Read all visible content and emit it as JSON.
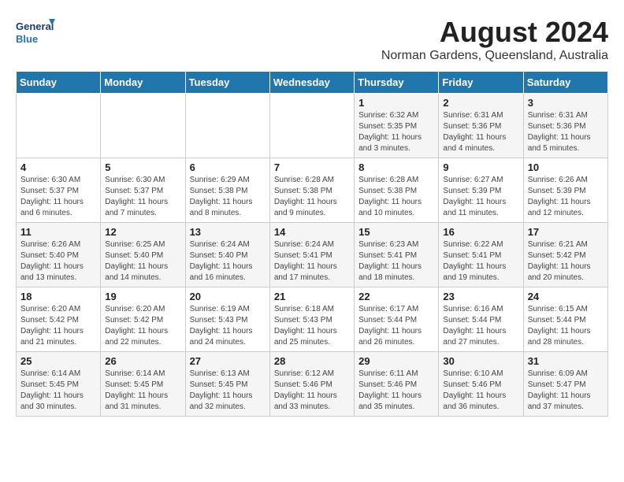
{
  "header": {
    "logo_line1": "General",
    "logo_line2": "Blue",
    "month_year": "August 2024",
    "location": "Norman Gardens, Queensland, Australia"
  },
  "weekdays": [
    "Sunday",
    "Monday",
    "Tuesday",
    "Wednesday",
    "Thursday",
    "Friday",
    "Saturday"
  ],
  "weeks": [
    [
      {
        "day": "",
        "info": ""
      },
      {
        "day": "",
        "info": ""
      },
      {
        "day": "",
        "info": ""
      },
      {
        "day": "",
        "info": ""
      },
      {
        "day": "1",
        "info": "Sunrise: 6:32 AM\nSunset: 5:35 PM\nDaylight: 11 hours\nand 3 minutes."
      },
      {
        "day": "2",
        "info": "Sunrise: 6:31 AM\nSunset: 5:36 PM\nDaylight: 11 hours\nand 4 minutes."
      },
      {
        "day": "3",
        "info": "Sunrise: 6:31 AM\nSunset: 5:36 PM\nDaylight: 11 hours\nand 5 minutes."
      }
    ],
    [
      {
        "day": "4",
        "info": "Sunrise: 6:30 AM\nSunset: 5:37 PM\nDaylight: 11 hours\nand 6 minutes."
      },
      {
        "day": "5",
        "info": "Sunrise: 6:30 AM\nSunset: 5:37 PM\nDaylight: 11 hours\nand 7 minutes."
      },
      {
        "day": "6",
        "info": "Sunrise: 6:29 AM\nSunset: 5:38 PM\nDaylight: 11 hours\nand 8 minutes."
      },
      {
        "day": "7",
        "info": "Sunrise: 6:28 AM\nSunset: 5:38 PM\nDaylight: 11 hours\nand 9 minutes."
      },
      {
        "day": "8",
        "info": "Sunrise: 6:28 AM\nSunset: 5:38 PM\nDaylight: 11 hours\nand 10 minutes."
      },
      {
        "day": "9",
        "info": "Sunrise: 6:27 AM\nSunset: 5:39 PM\nDaylight: 11 hours\nand 11 minutes."
      },
      {
        "day": "10",
        "info": "Sunrise: 6:26 AM\nSunset: 5:39 PM\nDaylight: 11 hours\nand 12 minutes."
      }
    ],
    [
      {
        "day": "11",
        "info": "Sunrise: 6:26 AM\nSunset: 5:40 PM\nDaylight: 11 hours\nand 13 minutes."
      },
      {
        "day": "12",
        "info": "Sunrise: 6:25 AM\nSunset: 5:40 PM\nDaylight: 11 hours\nand 14 minutes."
      },
      {
        "day": "13",
        "info": "Sunrise: 6:24 AM\nSunset: 5:40 PM\nDaylight: 11 hours\nand 16 minutes."
      },
      {
        "day": "14",
        "info": "Sunrise: 6:24 AM\nSunset: 5:41 PM\nDaylight: 11 hours\nand 17 minutes."
      },
      {
        "day": "15",
        "info": "Sunrise: 6:23 AM\nSunset: 5:41 PM\nDaylight: 11 hours\nand 18 minutes."
      },
      {
        "day": "16",
        "info": "Sunrise: 6:22 AM\nSunset: 5:41 PM\nDaylight: 11 hours\nand 19 minutes."
      },
      {
        "day": "17",
        "info": "Sunrise: 6:21 AM\nSunset: 5:42 PM\nDaylight: 11 hours\nand 20 minutes."
      }
    ],
    [
      {
        "day": "18",
        "info": "Sunrise: 6:20 AM\nSunset: 5:42 PM\nDaylight: 11 hours\nand 21 minutes."
      },
      {
        "day": "19",
        "info": "Sunrise: 6:20 AM\nSunset: 5:42 PM\nDaylight: 11 hours\nand 22 minutes."
      },
      {
        "day": "20",
        "info": "Sunrise: 6:19 AM\nSunset: 5:43 PM\nDaylight: 11 hours\nand 24 minutes."
      },
      {
        "day": "21",
        "info": "Sunrise: 6:18 AM\nSunset: 5:43 PM\nDaylight: 11 hours\nand 25 minutes."
      },
      {
        "day": "22",
        "info": "Sunrise: 6:17 AM\nSunset: 5:44 PM\nDaylight: 11 hours\nand 26 minutes."
      },
      {
        "day": "23",
        "info": "Sunrise: 6:16 AM\nSunset: 5:44 PM\nDaylight: 11 hours\nand 27 minutes."
      },
      {
        "day": "24",
        "info": "Sunrise: 6:15 AM\nSunset: 5:44 PM\nDaylight: 11 hours\nand 28 minutes."
      }
    ],
    [
      {
        "day": "25",
        "info": "Sunrise: 6:14 AM\nSunset: 5:45 PM\nDaylight: 11 hours\nand 30 minutes."
      },
      {
        "day": "26",
        "info": "Sunrise: 6:14 AM\nSunset: 5:45 PM\nDaylight: 11 hours\nand 31 minutes."
      },
      {
        "day": "27",
        "info": "Sunrise: 6:13 AM\nSunset: 5:45 PM\nDaylight: 11 hours\nand 32 minutes."
      },
      {
        "day": "28",
        "info": "Sunrise: 6:12 AM\nSunset: 5:46 PM\nDaylight: 11 hours\nand 33 minutes."
      },
      {
        "day": "29",
        "info": "Sunrise: 6:11 AM\nSunset: 5:46 PM\nDaylight: 11 hours\nand 35 minutes."
      },
      {
        "day": "30",
        "info": "Sunrise: 6:10 AM\nSunset: 5:46 PM\nDaylight: 11 hours\nand 36 minutes."
      },
      {
        "day": "31",
        "info": "Sunrise: 6:09 AM\nSunset: 5:47 PM\nDaylight: 11 hours\nand 37 minutes."
      }
    ]
  ]
}
